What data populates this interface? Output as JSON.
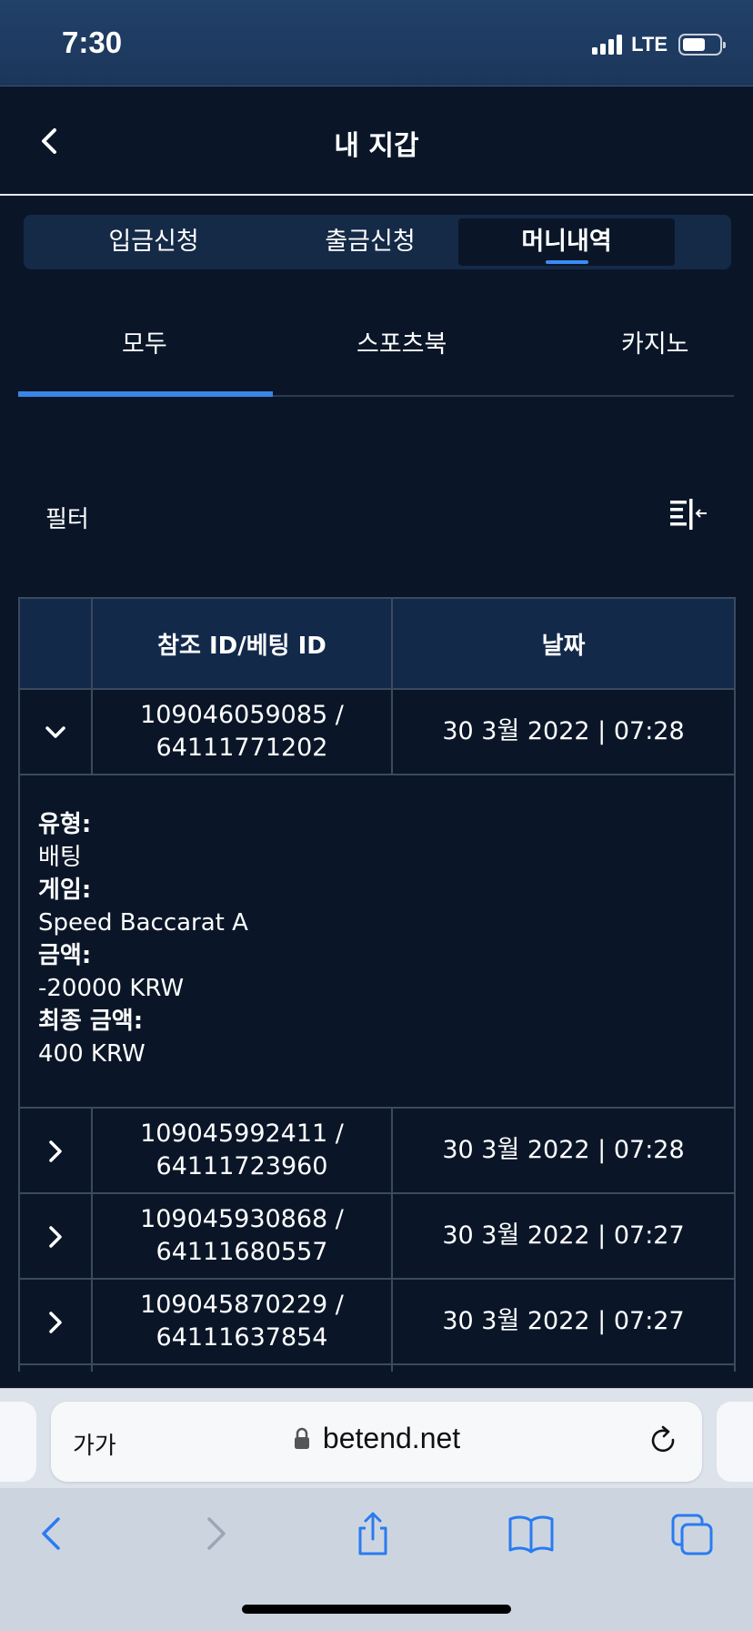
{
  "status_bar": {
    "time": "7:30",
    "network": "LTE"
  },
  "header": {
    "title": "내 지갑",
    "back_icon": "chevron-left-icon"
  },
  "segment_tabs": [
    {
      "label": "입금신청",
      "active": false
    },
    {
      "label": "출금신청",
      "active": false
    },
    {
      "label": "머니내역",
      "active": true
    }
  ],
  "sub_tabs": [
    {
      "label": "모두",
      "active": true
    },
    {
      "label": "스포츠북",
      "active": false
    },
    {
      "label": "카지노",
      "active": false
    }
  ],
  "filter": {
    "label": "필터",
    "icon": "filter-collapse-icon"
  },
  "table": {
    "headers": [
      "",
      "참조 ID/베팅 ID",
      "날짜"
    ],
    "rows": [
      {
        "ref_id": "109046059085 /",
        "bet_id": "64111771202",
        "date": "30 3월 2022 | 07:28",
        "expanded": true
      },
      {
        "ref_id": "109045992411 /",
        "bet_id": "64111723960",
        "date": "30 3월 2022 | 07:28",
        "expanded": false
      },
      {
        "ref_id": "109045930868 /",
        "bet_id": "64111680557",
        "date": "30 3월 2022 | 07:27",
        "expanded": false
      },
      {
        "ref_id": "109045870229 /",
        "bet_id": "64111637854",
        "date": "30 3월 2022 | 07:27",
        "expanded": false
      }
    ],
    "detail": {
      "type_label": "유형:",
      "type_value": "배팅",
      "game_label": "게임:",
      "game_value": "Speed Baccarat A",
      "amount_label": "금액:",
      "amount_value": "-20000 KRW",
      "final_label": "최종 금액:",
      "final_value": "400 KRW"
    }
  },
  "browser": {
    "text_size": "가가",
    "url": "betend.net"
  },
  "colors": {
    "background": "#0a1628",
    "accent": "#3a86e8",
    "header_bg": "#13294a"
  }
}
